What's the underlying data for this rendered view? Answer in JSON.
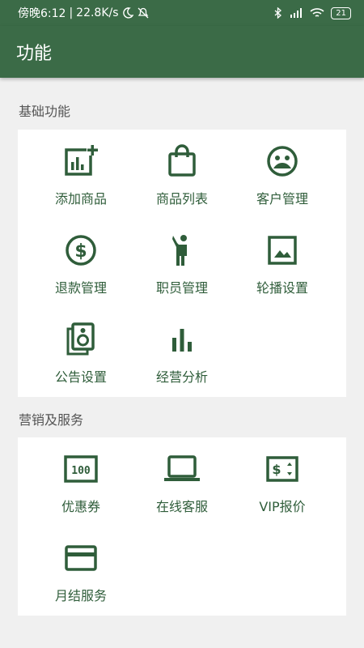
{
  "status_bar": {
    "time": "傍晚6:12",
    "speed": "22.8K/s",
    "battery": "21"
  },
  "app_bar": {
    "title": "功能"
  },
  "sections": [
    {
      "title": "基础功能",
      "items": [
        {
          "label": "添加商品",
          "icon": "add-chart-icon"
        },
        {
          "label": "商品列表",
          "icon": "shopping-bag-icon"
        },
        {
          "label": "客户管理",
          "icon": "customer-face-icon"
        },
        {
          "label": "退款管理",
          "icon": "dollar-circle-icon"
        },
        {
          "label": "职员管理",
          "icon": "staff-person-icon"
        },
        {
          "label": "轮播设置",
          "icon": "image-icon"
        },
        {
          "label": "公告设置",
          "icon": "speaker-icon"
        },
        {
          "label": "经营分析",
          "icon": "bar-chart-icon"
        }
      ]
    },
    {
      "title": "营销及服务",
      "items": [
        {
          "label": "优惠券",
          "icon": "coupon-100-icon"
        },
        {
          "label": "在线客服",
          "icon": "laptop-icon"
        },
        {
          "label": "VIP报价",
          "icon": "price-tag-icon"
        },
        {
          "label": "月结服务",
          "icon": "credit-card-icon"
        }
      ]
    }
  ],
  "colors": {
    "primary": "#3b6b47",
    "icon": "#2f5d3a",
    "background": "#f0f0f0",
    "card": "#ffffff"
  }
}
